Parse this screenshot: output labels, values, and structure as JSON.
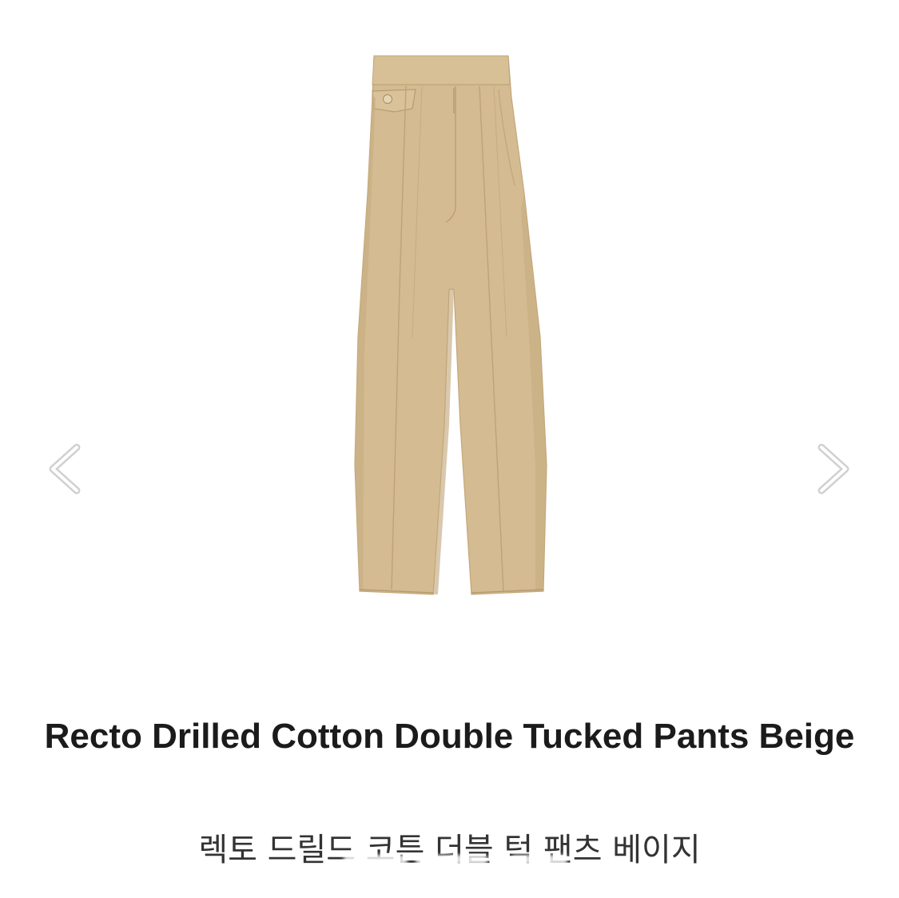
{
  "product": {
    "title": "Recto Drilled Cotton Double Tucked Pants Beige",
    "subtitle": "렉토 드릴드 코튼 더블 턱 팬츠 베이지",
    "image_subject": "beige-pleated-pants",
    "colors": {
      "fabric": "#d4bb91",
      "fabric_shadow": "#c4a97d",
      "fabric_highlight": "#dcc6a0",
      "button": "#e6d5b5",
      "title": "#1b1b1b",
      "subtitle": "#333333"
    }
  },
  "carousel": {
    "prev_icon": "chevron-left-icon",
    "next_icon": "chevron-right-icon"
  }
}
